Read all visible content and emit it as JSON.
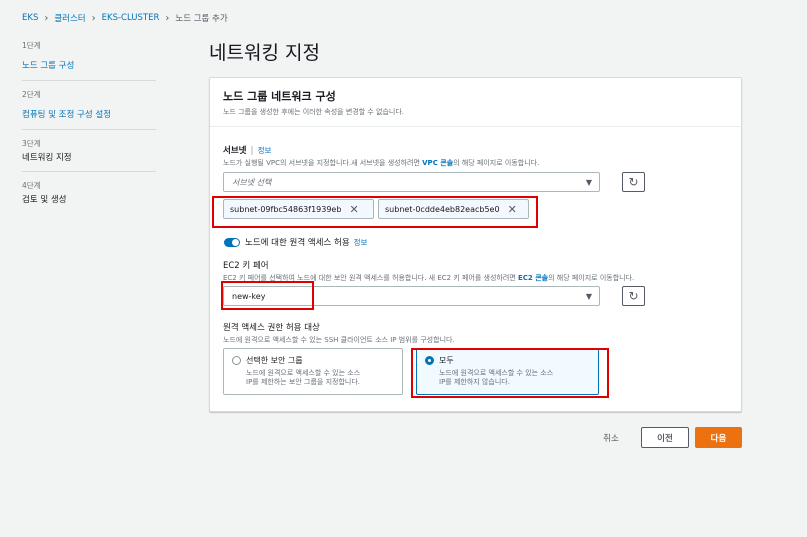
{
  "breadcrumb": {
    "items": [
      "EKS",
      "클러스터",
      "EKS-CLUSTER"
    ],
    "current": "노드 그룹 추가"
  },
  "steps": [
    {
      "num": "1단계",
      "label": "노드 그룹 구성"
    },
    {
      "num": "2단계",
      "label": "컴퓨팅 및 조정 구성 설정"
    },
    {
      "num": "3단계",
      "label": "네트워킹 지정"
    },
    {
      "num": "4단계",
      "label": "검토 및 생성"
    }
  ],
  "page_title": "네트워킹 지정",
  "panel": {
    "title": "노드 그룹 네트워크 구성",
    "desc": "노드 그룹을 생성한 후에는 이러한 속성을 변경할 수 없습니다."
  },
  "subnet": {
    "label": "서브넷",
    "info": "정보",
    "desc_prefix": "노드가 실행될 VPC의 서브넷을 지정합니다.새 서브넷을 생성하려면 ",
    "desc_link": "VPC 콘솔",
    "desc_suffix": "의 해당 페이지로 이동합니다.",
    "placeholder": "서브넷 선택",
    "tokens": [
      "subnet-09fbc54863f1939eb",
      "subnet-0cdde4eb82eacb5e0"
    ]
  },
  "remote_access": {
    "toggle_label": "노드에 대한 원격 액세스 허용",
    "info": "정보",
    "enabled": true
  },
  "keypair": {
    "label": "EC2 키 페어",
    "desc_prefix": "EC2 키 페어를 선택하여 노드에 대한 보안 원격 액세스를 허용합니다. 새 EC2 키 페어를 생성하려면 ",
    "desc_link": "EC2 콘솔",
    "desc_suffix": "의 해당 페이지로 이동합니다.",
    "value": "new-key"
  },
  "source": {
    "label": "원격 액세스 권한 허용 대상",
    "desc": "노드에 원격으로 액세스할 수 있는 SSH 클라이언트 소스 IP 범위를 구성합니다.",
    "options": [
      {
        "title": "선택한 보안 그룹",
        "desc1": "노드에 원격으로 액세스할 수 있는 소스",
        "desc2": "IP를 제한하는 보안 그룹을 지정합니다."
      },
      {
        "title": "모두",
        "desc1": "노드에 원격으로 액세스할 수 있는 소스",
        "desc2": "IP를 제한하지 않습니다."
      }
    ],
    "selected": "모두"
  },
  "footer": {
    "cancel": "취소",
    "prev": "이전",
    "next": "다음"
  },
  "icons": {
    "caret": "caret-down-icon",
    "refresh": "refresh-icon",
    "remove": "close-icon"
  },
  "colors": {
    "link": "#0073bb",
    "primary": "#ec7211",
    "highlight": "#e00000"
  }
}
